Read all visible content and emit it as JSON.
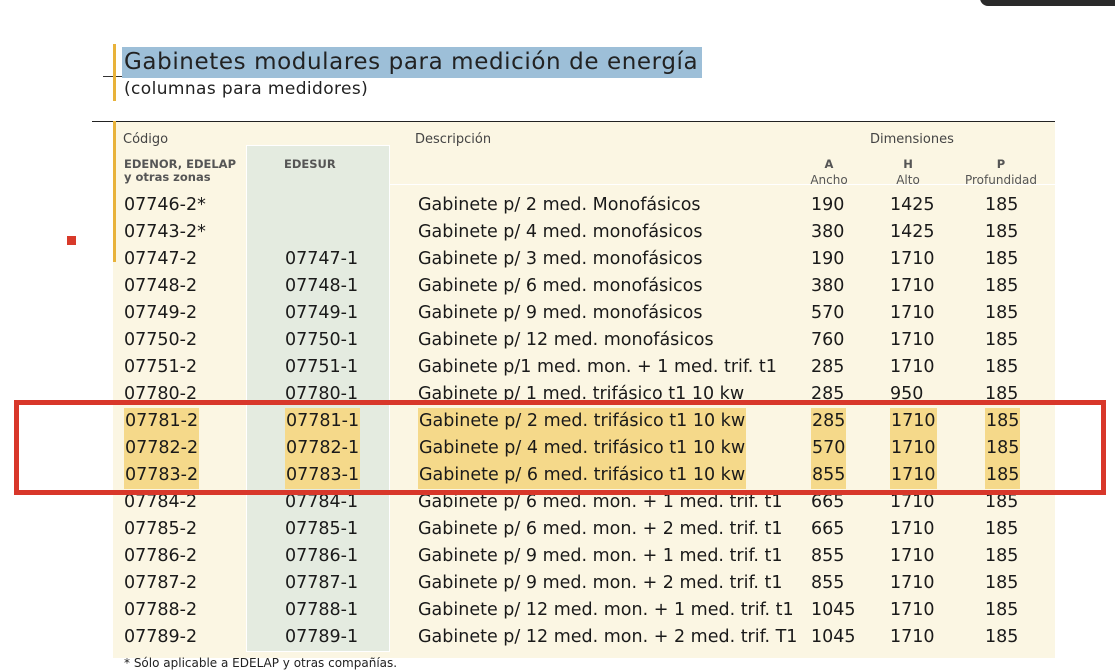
{
  "title": "Gabinetes modulares para medición de energía",
  "subtitle": "(columnas para medidores)",
  "headers": {
    "codigo": "Código",
    "edenor": "EDENOR, EDELAP",
    "edenor_2": "y otras zonas",
    "edesur": "EDESUR",
    "descripcion": "Descripción",
    "dimensiones": "Dimensiones",
    "a": "A",
    "a_label": "Ancho",
    "h": "H",
    "h_label": "Alto",
    "p": "P",
    "p_label": "Profundidad"
  },
  "rows": [
    {
      "code": "07746-2*",
      "edesur": "",
      "desc": "Gabinete p/ 2 med. Monofásicos",
      "a": "190",
      "h": "1425",
      "p": "185",
      "highlighted": false
    },
    {
      "code": "07743-2*",
      "edesur": "",
      "desc": "Gabinete p/ 4 med. monofásicos",
      "a": "380",
      "h": "1425",
      "p": "185",
      "highlighted": false
    },
    {
      "code": "07747-2",
      "edesur": "07747-1",
      "desc": "Gabinete p/ 3 med. monofásicos",
      "a": "190",
      "h": "1710",
      "p": "185",
      "highlighted": false
    },
    {
      "code": "07748-2",
      "edesur": "07748-1",
      "desc": "Gabinete p/ 6 med. monofásicos",
      "a": "380",
      "h": "1710",
      "p": "185",
      "highlighted": false
    },
    {
      "code": "07749-2",
      "edesur": "07749-1",
      "desc": "Gabinete p/ 9 med. monofásicos",
      "a": "570",
      "h": "1710",
      "p": "185",
      "highlighted": false
    },
    {
      "code": "07750-2",
      "edesur": "07750-1",
      "desc": "Gabinete p/ 12 med. monofásicos",
      "a": "760",
      "h": "1710",
      "p": "185",
      "highlighted": false
    },
    {
      "code": "07751-2",
      "edesur": "07751-1",
      "desc": "Gabinete p/1 med. mon. + 1 med. trif. t1",
      "a": "285",
      "h": "1710",
      "p": "185",
      "highlighted": false
    },
    {
      "code": "07780-2",
      "edesur": "07780-1",
      "desc": "Gabinete p/ 1 med. trifásico t1 10 kw",
      "a": "285",
      "h": "950",
      "p": "185",
      "highlighted": false
    },
    {
      "code": "07781-2",
      "edesur": "07781-1",
      "desc": "Gabinete p/ 2 med. trifásico t1 10 kw",
      "a": "285",
      "h": "1710",
      "p": "185",
      "highlighted": true
    },
    {
      "code": "07782-2",
      "edesur": "07782-1",
      "desc": "Gabinete p/ 4 med. trifásico t1 10 kw",
      "a": "570",
      "h": "1710",
      "p": "185",
      "highlighted": true
    },
    {
      "code": "07783-2",
      "edesur": "07783-1",
      "desc": "Gabinete p/ 6 med. trifásico t1 10 kw",
      "a": "855",
      "h": "1710",
      "p": "185",
      "highlighted": true
    },
    {
      "code": "07784-2",
      "edesur": "07784-1",
      "desc": "Gabinete p/ 6 med. mon. + 1 med. trif. t1",
      "a": "665",
      "h": "1710",
      "p": "185",
      "highlighted": false
    },
    {
      "code": "07785-2",
      "edesur": "07785-1",
      "desc": "Gabinete p/ 6 med. mon. + 2 med. trif. t1",
      "a": "665",
      "h": "1710",
      "p": "185",
      "highlighted": false
    },
    {
      "code": "07786-2",
      "edesur": "07786-1",
      "desc": "Gabinete p/ 9 med. mon. + 1 med. trif. t1",
      "a": "855",
      "h": "1710",
      "p": "185",
      "highlighted": false
    },
    {
      "code": "07787-2",
      "edesur": "07787-1",
      "desc": "Gabinete p/ 9 med. mon. + 2 med. trif. t1",
      "a": "855",
      "h": "1710",
      "p": "185",
      "highlighted": false
    },
    {
      "code": "07788-2",
      "edesur": "07788-1",
      "desc": "Gabinete p/ 12 med. mon. + 1 med. trif. t1",
      "a": "1045",
      "h": "1710",
      "p": "185",
      "highlighted": false
    },
    {
      "code": "07789-2",
      "edesur": "07789-1",
      "desc": "Gabinete p/ 12 med. mon. + 2 med. trif. T1",
      "a": "1045",
      "h": "1710",
      "p": "185",
      "highlighted": false
    }
  ],
  "footnote": "* Sólo aplicable a EDELAP y otras compañías.",
  "colors": {
    "title_highlight": "#9dbfd8",
    "accent": "#e8b23a",
    "panel": "#fbf6e3",
    "edesur_column": "#e4ebe0",
    "row_highlight": "#f5d98a",
    "red_box": "#d8372a"
  }
}
